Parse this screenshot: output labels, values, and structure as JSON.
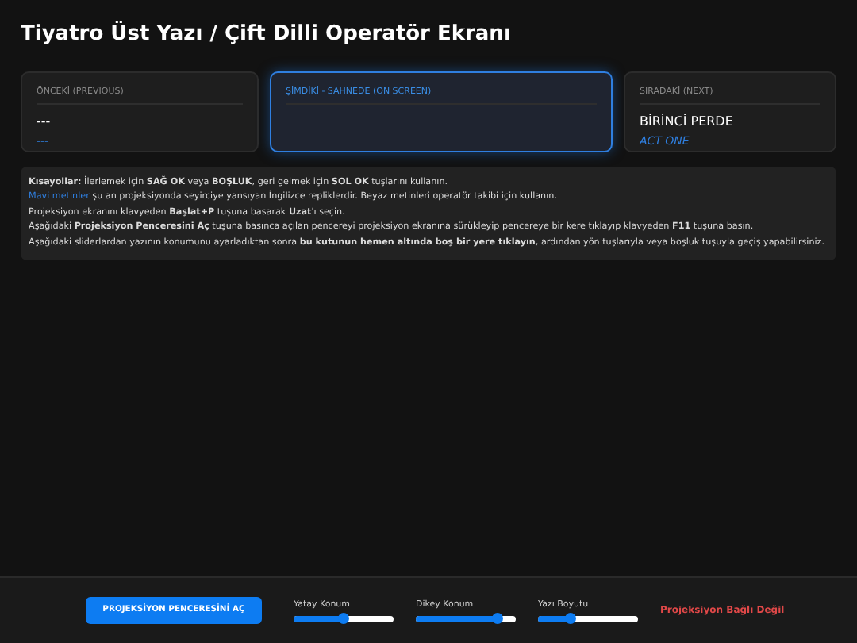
{
  "title": "Tiyatro Üst Yazı / Çift Dilli Operatör Ekranı",
  "cards": [
    {
      "label": "ÖNCEKİ (PREVIOUS)",
      "main": "---",
      "translation": "---",
      "selected": false
    },
    {
      "label": "ŞİMDİKİ - SAHNEDE (ON SCREEN)",
      "selected": true
    },
    {
      "label": "SIRADAKİ (NEXT)",
      "main": "BİRİNCİ PERDE",
      "translation": "ACT ONE",
      "selected": false
    }
  ],
  "info": [
    {
      "text": "**Kısayollar:** İlerlemek için **SAĞ OK** veya **BOŞLUK**, geri gelmek için **SOL OK** tuşlarını kullanın."
    },
    {
      "highlight": "Mavi metinler",
      "text": " şu an projeksiyonda seyirciye yansıyan İngilizce repliklerdir. Beyaz metinleri operatör takibi için kullanın."
    },
    {
      "text": "Projeksiyon ekranını klavyeden **Başlat+P** tuşuna basarak **Uzat**'ı seçin."
    },
    {
      "text": "Aşağıdaki **Projeksiyon Penceresini Aç** tuşuna basınca açılan pencereyi projeksiyon ekranına sürükleyip pencereye bir kere tıklayıp klavyeden **F11** tuşuna basın."
    },
    {
      "text": "Aşağıdaki sliderlardan yazının konumunu ayarladıktan sonra **bu kutunun hemen altında boş bir yere tıklayın**, ardından yön tuşlarıyla veya boşluk tuşuyla geçiş yapabilirsiniz."
    }
  ],
  "footer": {
    "button": "PROJEKSİYON PENCERESİNİ AÇ",
    "sliders": [
      {
        "label": "Yatay Konum",
        "level": 0.5
      },
      {
        "label": "Dikey Konum",
        "level": 0.82
      },
      {
        "label": "Yazı Boyutu",
        "level": 0.32
      }
    ],
    "status": "Projeksiyon Bağlı Değil"
  }
}
